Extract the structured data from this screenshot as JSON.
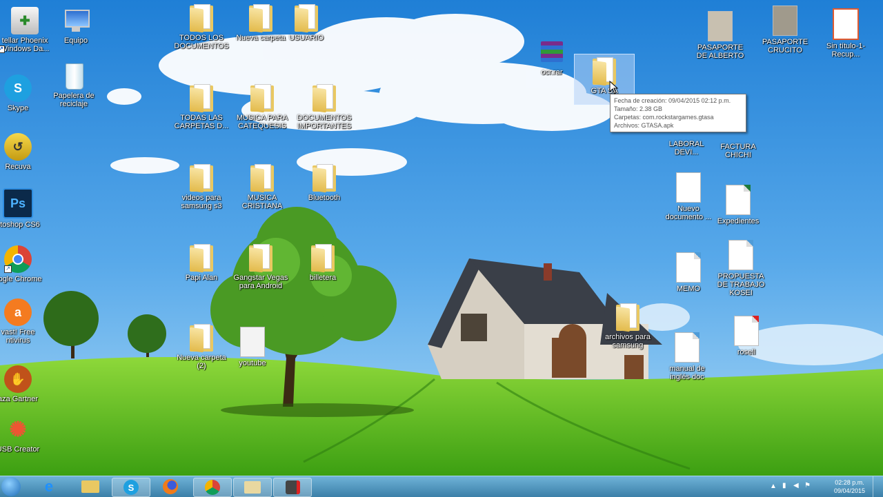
{
  "desktop": {
    "icons_left": [
      {
        "label": "tellar Phoenix Windows Da...",
        "icon": "stellar-phoenix-icon"
      },
      {
        "label": "Equipo",
        "icon": "computer-icon"
      },
      {
        "label": "Papelera de reciclaje",
        "icon": "recycle-bin-icon"
      },
      {
        "label": "Skype",
        "icon": "skype-icon"
      },
      {
        "label": "Recuva",
        "icon": "recuva-icon"
      },
      {
        "label": "otoshop CS6",
        "icon": "photoshop-icon"
      },
      {
        "label": "oogle Chrome",
        "icon": "chrome-icon"
      },
      {
        "label": "vast! Free ntivirus",
        "icon": "avast-icon"
      },
      {
        "label": "aza Gartner",
        "icon": "app-icon"
      },
      {
        "label": "USB Creator",
        "icon": "usb-creator-icon"
      }
    ],
    "folders": [
      {
        "label": "TODOS LOS DOCUMENTOS"
      },
      {
        "label": "Nueva carpeta"
      },
      {
        "label": "USUARIO"
      },
      {
        "label": "TODAS LAS CARPETAS D..."
      },
      {
        "label": "MUSICA PARA CATEQUESIS"
      },
      {
        "label": "DOCUMENTOS IMPORTANTES"
      },
      {
        "label": "videos para samsung s3"
      },
      {
        "label": "MUSICA CRISTIANA"
      },
      {
        "label": "Bluetooth"
      },
      {
        "label": "Papi Alan"
      },
      {
        "label": "Gangstar Vegas para Android"
      },
      {
        "label": "billetera"
      },
      {
        "label": "Nueva carpeta (2)"
      },
      {
        "label": "youtube"
      }
    ],
    "archive": {
      "label": "ocr.rar"
    },
    "selected": {
      "label": "GTA SA"
    },
    "tooltip": {
      "creation": "Fecha de creación: 09/04/2015 02:12 p.m.",
      "size": "Tamaño: 2.38 GB",
      "folders": "Carpetas: com.rockstargames.gtasa",
      "files": "Archivos: GTASA.apk"
    },
    "icons_right": [
      {
        "label": "PASAPORTE DE ALBERTO"
      },
      {
        "label": "PASAPORTE CRUCITO"
      },
      {
        "label": "Sin título-1-Recup..."
      },
      {
        "label": "LABORAL DEVI..."
      },
      {
        "label": "FACTURA CHICHI"
      },
      {
        "label": "Nuevo documento ..."
      },
      {
        "label": "Expedientes"
      },
      {
        "label": "MEMO"
      },
      {
        "label": "PROPUESTA DE TRABAJO KOSEI"
      },
      {
        "label": "archivos para samsung"
      },
      {
        "label": "manual de inglés doc"
      },
      {
        "label": "rosell"
      }
    ]
  },
  "taskbar": {
    "items": [
      {
        "name": "ie-icon",
        "open": false
      },
      {
        "name": "file-explorer-icon",
        "open": false
      },
      {
        "name": "skype-icon",
        "open": true
      },
      {
        "name": "firefox-icon",
        "open": false
      },
      {
        "name": "chrome-icon",
        "open": true
      },
      {
        "name": "folder-icon",
        "open": true
      },
      {
        "name": "recorder-icon",
        "open": true
      }
    ],
    "clock_time": "02:28 p.m.",
    "clock_date": "09/04/2015"
  }
}
